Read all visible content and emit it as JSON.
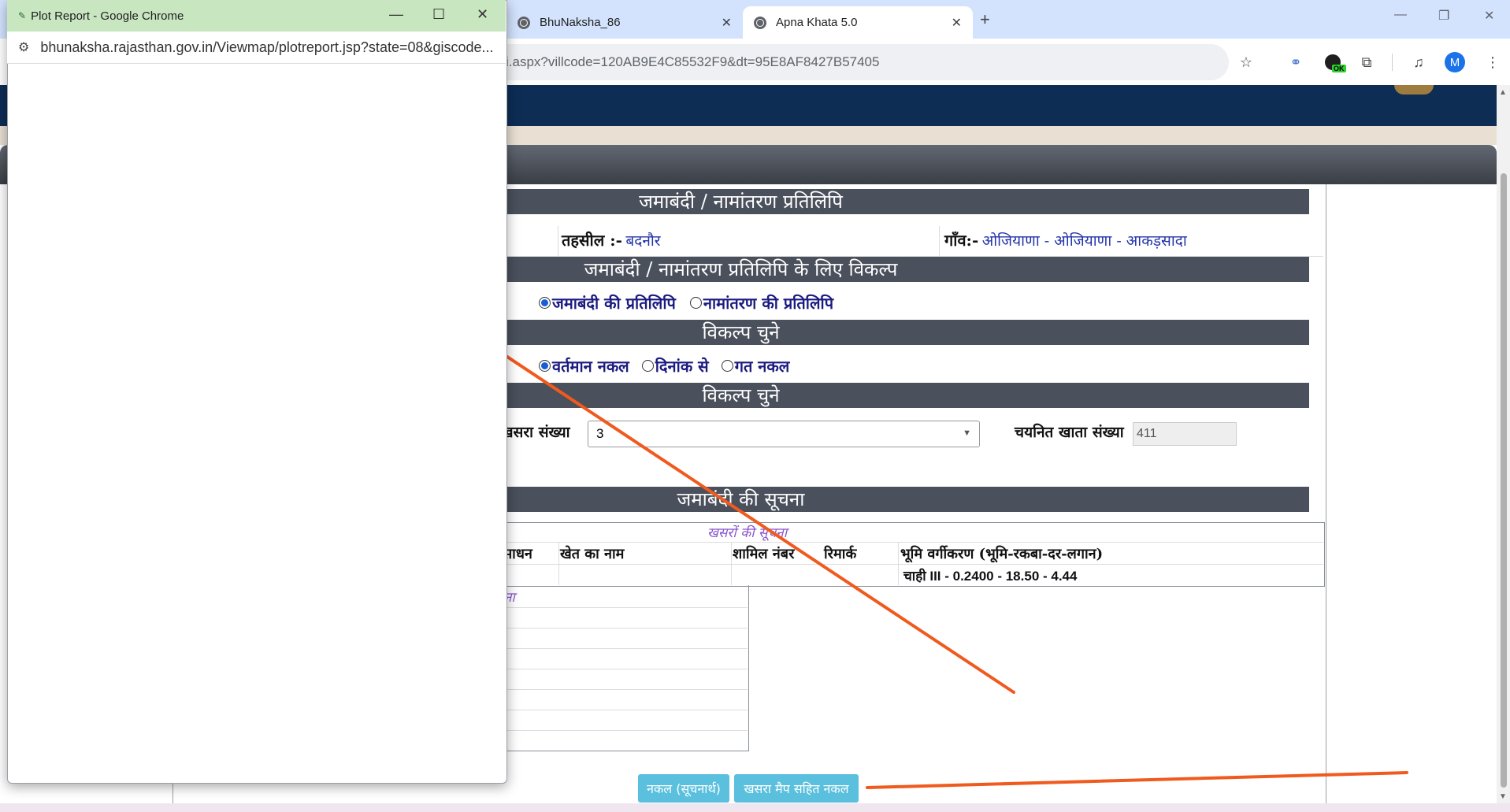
{
  "browser": {
    "tabs": [
      {
        "title": "BhuNaksha_86",
        "active": false
      },
      {
        "title": "Apna Khata 5.0",
        "active": true
      }
    ],
    "url": "i.aspx?villcode=120AB9E4C85532F9&dt=95E8AF8427B57405",
    "profile_initial": "M",
    "extension_badge": "OK"
  },
  "popup": {
    "title": "Plot Report - Google Chrome",
    "url": "bhunaksha.rajasthan.gov.in/Viewmap/plotreport.jsp?state=08&giscode..."
  },
  "form": {
    "header": "जमाबंदी / नामांतरण प्रतिलिपि",
    "tehsil_label": "तहसील :-",
    "tehsil_value": "बदनौर",
    "gaon_label": "गाँव:-",
    "gaon_value": "ओजियाणा - ओजियाणा - आकड़सादा",
    "options_header": "जमाबंदी / नामांतरण प्रतिलिपि के लिए विकल्प",
    "copy_type_options": [
      {
        "label": "जमाबंदी की प्रतिलिपि",
        "selected": true
      },
      {
        "label": "नामांतरण की प्रतिलिपि",
        "selected": false
      }
    ],
    "choose_header_1": "विकल्प चुने",
    "period_options": [
      {
        "label": "वर्तमान नकल",
        "selected": true
      },
      {
        "label": "दिनांक से",
        "selected": false
      },
      {
        "label": "गत नकल",
        "selected": false
      }
    ],
    "choose_header_2": "विकल्प चुने",
    "khasra_label": "खसरा संख्या",
    "khasra_value": "3",
    "khata_label": "चयनित खाता संख्या",
    "khata_value": "411",
    "info_header": "जमाबंदी की सूचना",
    "khasra_info_title": "खसरों की सूचना",
    "columns": [
      "साधन",
      "खेत का नाम",
      "शामिल नंबर",
      "रिमार्क",
      "भूमि वर्गीकरण (भूमि-रकबा-दर-लगान)"
    ],
    "row_value": "चाही III - 0.2400 - 18.50 - 4.44",
    "lower_title_fragment": "ना",
    "btn_nakal": "नकल (सूचनार्थ)",
    "btn_map_nakal": "खसरा मैप सहित नकल"
  },
  "colors": {
    "annotation": "#f05a1e",
    "section_bar": "#4a505c",
    "button": "#5bc0de"
  }
}
